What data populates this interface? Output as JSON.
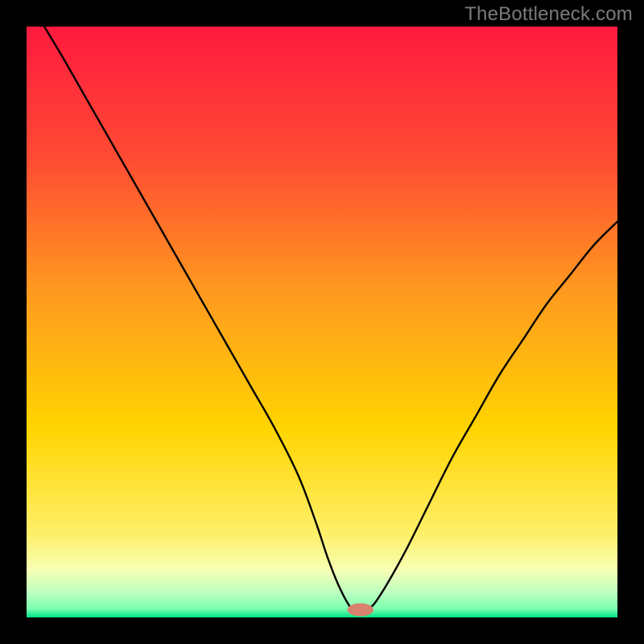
{
  "watermark": "TheBottleneck.com",
  "colors": {
    "frame": "#000000",
    "gradient_top": "#ff1a3f",
    "gradient_mid_upper": "#ff6a2a",
    "gradient_mid": "#ffd400",
    "gradient_low": "#fff8a0",
    "gradient_bottom_band": "#f6ffb4",
    "gradient_green_light": "#7dffb0",
    "gradient_green": "#00e38a",
    "curve": "#000000",
    "marker_fill": "#d9816f",
    "marker_stroke": "#be6a58"
  },
  "chart_data": {
    "type": "line",
    "title": "",
    "xlabel": "",
    "ylabel": "",
    "xlim": [
      0,
      100
    ],
    "ylim": [
      0,
      100
    ],
    "series": [
      {
        "name": "bottleneck-curve",
        "x": [
          3,
          6,
          10,
          14,
          18,
          22,
          26,
          30,
          34,
          38,
          42,
          46,
          49,
          51,
          53,
          55,
          56.5,
          58,
          60,
          64,
          68,
          72,
          76,
          80,
          84,
          88,
          92,
          96,
          100
        ],
        "y": [
          100,
          95,
          88,
          81,
          74,
          67,
          60,
          53,
          46,
          39,
          32,
          24,
          16,
          10,
          5,
          1.5,
          1.3,
          1.5,
          4,
          11,
          19,
          27,
          34,
          41,
          47,
          53,
          58,
          63,
          67
        ]
      }
    ],
    "marker": {
      "x": 56.5,
      "y": 1.3,
      "rx": 2.2,
      "ry": 1.1
    }
  }
}
